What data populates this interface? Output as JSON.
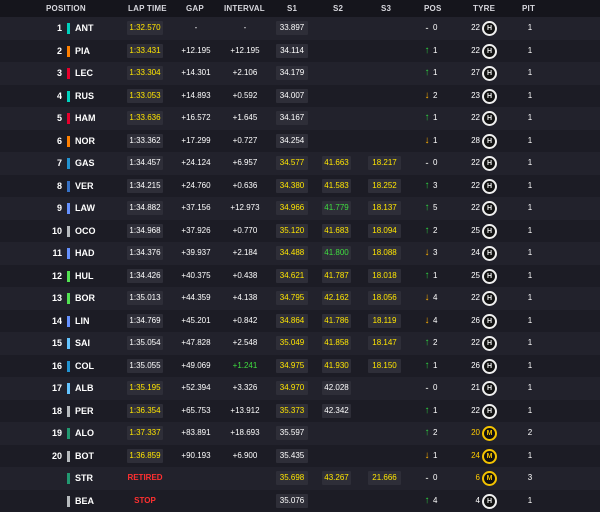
{
  "header": {
    "position": "POSITION",
    "lap_time": "LAP TIME",
    "gap": "GAP",
    "interval": "INTERVAL",
    "s1": "S1",
    "s2": "S2",
    "s3": "S3",
    "pos": "POS",
    "tyre": "TYRE",
    "pit": "PIT"
  },
  "colors": {
    "background": "#1b1b23",
    "sector_purple_or_pb_yellow": "#ffe600",
    "personal_best_green": "#3fdc3f",
    "gain_green": "#2ecc40",
    "loss_amber": "#ffb000",
    "retired_red": "#ff3030",
    "medium_tyre": "#f4c300",
    "hard_tyre": "#f0f0f0"
  },
  "rows": [
    {
      "pos": "1",
      "code": "ANT",
      "team_color": "#00d2be",
      "lap": "1:32.570",
      "lap_style": "yellow box",
      "gap": "-",
      "int": "-",
      "s1": "33.897",
      "s1_style": "white box",
      "s2": "",
      "s2_style": "",
      "s3": "",
      "s3_style": "",
      "dir": "flat",
      "chg": "0",
      "laps": "22",
      "tyre_type": "hard",
      "tyre": "H",
      "pit": "1"
    },
    {
      "pos": "2",
      "code": "PIA",
      "team_color": "#ff8000",
      "lap": "1:33.431",
      "lap_style": "yellow box",
      "gap": "+12.195",
      "int": "+12.195",
      "s1": "34.114",
      "s1_style": "white box",
      "s2": "",
      "s2_style": "",
      "s3": "",
      "s3_style": "",
      "dir": "up",
      "chg": "1",
      "laps": "22",
      "tyre_type": "hard",
      "tyre": "H",
      "pit": "1"
    },
    {
      "pos": "3",
      "code": "LEC",
      "team_color": "#e8002d",
      "lap": "1:33.304",
      "lap_style": "yellow box",
      "gap": "+14.301",
      "int": "+2.106",
      "s1": "34.179",
      "s1_style": "white box",
      "s2": "",
      "s2_style": "",
      "s3": "",
      "s3_style": "",
      "dir": "up",
      "chg": "1",
      "laps": "27",
      "tyre_type": "hard",
      "tyre": "H",
      "pit": "1"
    },
    {
      "pos": "4",
      "code": "RUS",
      "team_color": "#00d2be",
      "lap": "1:33.053",
      "lap_style": "yellow box",
      "gap": "+14.893",
      "int": "+0.592",
      "s1": "34.007",
      "s1_style": "white box",
      "s2": "",
      "s2_style": "",
      "s3": "",
      "s3_style": "",
      "dir": "down",
      "chg": "2",
      "laps": "23",
      "tyre_type": "hard",
      "tyre": "H",
      "pit": "1"
    },
    {
      "pos": "5",
      "code": "HAM",
      "team_color": "#e8002d",
      "lap": "1:33.636",
      "lap_style": "yellow box",
      "gap": "+16.572",
      "int": "+1.645",
      "s1": "34.167",
      "s1_style": "white box",
      "s2": "",
      "s2_style": "",
      "s3": "",
      "s3_style": "",
      "dir": "up",
      "chg": "1",
      "laps": "22",
      "tyre_type": "hard",
      "tyre": "H",
      "pit": "1"
    },
    {
      "pos": "6",
      "code": "NOR",
      "team_color": "#ff8000",
      "lap": "1:33.362",
      "lap_style": "white box",
      "gap": "+17.299",
      "int": "+0.727",
      "s1": "34.254",
      "s1_style": "white box",
      "s2": "",
      "s2_style": "",
      "s3": "",
      "s3_style": "",
      "dir": "down",
      "chg": "1",
      "laps": "28",
      "tyre_type": "hard",
      "tyre": "H",
      "pit": "1"
    },
    {
      "pos": "7",
      "code": "GAS",
      "team_color": "#2293d1",
      "lap": "1:34.457",
      "lap_style": "white box",
      "gap": "+24.124",
      "int": "+6.957",
      "s1": "34.577",
      "s1_style": "yellow box",
      "s2": "41.663",
      "s2_style": "yellow box",
      "s3": "18.217",
      "s3_style": "yellow box",
      "dir": "flat",
      "chg": "0",
      "laps": "22",
      "tyre_type": "hard",
      "tyre": "H",
      "pit": "1"
    },
    {
      "pos": "8",
      "code": "VER",
      "team_color": "#3671c6",
      "lap": "1:34.215",
      "lap_style": "white box",
      "gap": "+24.760",
      "int": "+0.636",
      "s1": "34.380",
      "s1_style": "yellow box",
      "s2": "41.583",
      "s2_style": "yellow box",
      "s3": "18.252",
      "s3_style": "yellow box",
      "dir": "up",
      "chg": "3",
      "laps": "22",
      "tyre_type": "hard",
      "tyre": "H",
      "pit": "1"
    },
    {
      "pos": "9",
      "code": "LAW",
      "team_color": "#6692ff",
      "lap": "1:34.882",
      "lap_style": "white box",
      "gap": "+37.156",
      "int": "+12.973",
      "s1": "34.966",
      "s1_style": "yellow box",
      "s2": "41.779",
      "s2_style": "green box",
      "s3": "18.137",
      "s3_style": "yellow box",
      "dir": "up",
      "chg": "5",
      "laps": "22",
      "tyre_type": "hard",
      "tyre": "H",
      "pit": "1"
    },
    {
      "pos": "10",
      "code": "OCO",
      "team_color": "#b6babd",
      "lap": "1:34.968",
      "lap_style": "white box",
      "gap": "+37.926",
      "int": "+0.770",
      "s1": "35.120",
      "s1_style": "yellow box",
      "s2": "41.683",
      "s2_style": "yellow box",
      "s3": "18.094",
      "s3_style": "yellow box",
      "dir": "up",
      "chg": "2",
      "laps": "25",
      "tyre_type": "hard",
      "tyre": "H",
      "pit": "1"
    },
    {
      "pos": "11",
      "code": "HAD",
      "team_color": "#6692ff",
      "lap": "1:34.376",
      "lap_style": "white box",
      "gap": "+39.937",
      "int": "+2.184",
      "s1": "34.488",
      "s1_style": "yellow box",
      "s2": "41.800",
      "s2_style": "green box",
      "s3": "18.088",
      "s3_style": "yellow box",
      "dir": "down",
      "chg": "3",
      "laps": "24",
      "tyre_type": "hard",
      "tyre": "H",
      "pit": "1"
    },
    {
      "pos": "12",
      "code": "HUL",
      "team_color": "#52e252",
      "lap": "1:34.426",
      "lap_style": "white box",
      "gap": "+40.375",
      "int": "+0.438",
      "s1": "34.621",
      "s1_style": "yellow box",
      "s2": "41.787",
      "s2_style": "yellow box",
      "s3": "18.018",
      "s3_style": "yellow box",
      "dir": "up",
      "chg": "1",
      "laps": "25",
      "tyre_type": "hard",
      "tyre": "H",
      "pit": "1"
    },
    {
      "pos": "13",
      "code": "BOR",
      "team_color": "#52e252",
      "lap": "1:35.013",
      "lap_style": "white box",
      "gap": "+44.359",
      "int": "+4.138",
      "s1": "34.795",
      "s1_style": "yellow box",
      "s2": "42.162",
      "s2_style": "yellow box",
      "s3": "18.056",
      "s3_style": "yellow box",
      "dir": "down",
      "chg": "4",
      "laps": "22",
      "tyre_type": "hard",
      "tyre": "H",
      "pit": "1"
    },
    {
      "pos": "14",
      "code": "LIN",
      "team_color": "#6692ff",
      "lap": "1:34.769",
      "lap_style": "white box",
      "gap": "+45.201",
      "int": "+0.842",
      "s1": "34.864",
      "s1_style": "yellow box",
      "s2": "41.786",
      "s2_style": "yellow box",
      "s3": "18.119",
      "s3_style": "yellow box",
      "dir": "down",
      "chg": "4",
      "laps": "26",
      "tyre_type": "hard",
      "tyre": "H",
      "pit": "1"
    },
    {
      "pos": "15",
      "code": "SAI",
      "team_color": "#64c4ff",
      "lap": "1:35.054",
      "lap_style": "white box",
      "gap": "+47.828",
      "int": "+2.548",
      "s1": "35.049",
      "s1_style": "yellow box",
      "s2": "41.858",
      "s2_style": "yellow box",
      "s3": "18.147",
      "s3_style": "yellow box",
      "dir": "up",
      "chg": "2",
      "laps": "22",
      "tyre_type": "hard",
      "tyre": "H",
      "pit": "1"
    },
    {
      "pos": "16",
      "code": "COL",
      "team_color": "#2293d1",
      "lap": "1:35.055",
      "lap_style": "white box",
      "gap": "+49.069",
      "int": "+1.241",
      "int_style": "green",
      "s1": "34.975",
      "s1_style": "yellow box",
      "s2": "41.930",
      "s2_style": "yellow box",
      "s3": "18.150",
      "s3_style": "yellow box",
      "dir": "up",
      "chg": "1",
      "laps": "26",
      "tyre_type": "hard",
      "tyre": "H",
      "pit": "1"
    },
    {
      "pos": "17",
      "code": "ALB",
      "team_color": "#64c4ff",
      "lap": "1:35.195",
      "lap_style": "yellow box",
      "gap": "+52.394",
      "int": "+3.326",
      "s1": "34.970",
      "s1_style": "yellow box",
      "s2": "42.028",
      "s2_style": "white box",
      "s3": "",
      "s3_style": "",
      "dir": "flat",
      "chg": "0",
      "laps": "21",
      "tyre_type": "hard",
      "tyre": "H",
      "pit": "1"
    },
    {
      "pos": "18",
      "code": "PER",
      "team_color": "#b6babd",
      "lap": "1:36.354",
      "lap_style": "yellow box",
      "gap": "+65.753",
      "int": "+13.912",
      "s1": "35.373",
      "s1_style": "yellow box",
      "s2": "42.342",
      "s2_style": "white box",
      "s3": "",
      "s3_style": "",
      "dir": "up",
      "chg": "1",
      "laps": "22",
      "tyre_type": "hard",
      "tyre": "H",
      "pit": "1"
    },
    {
      "pos": "19",
      "code": "ALO",
      "team_color": "#229971",
      "lap": "1:37.337",
      "lap_style": "yellow box",
      "gap": "+83.891",
      "int": "+18.693",
      "s1": "35.597",
      "s1_style": "white box",
      "s2": "",
      "s2_style": "",
      "s3": "",
      "s3_style": "",
      "dir": "up",
      "chg": "2",
      "laps": "20",
      "laps_hl": true,
      "tyre_type": "medium",
      "tyre": "M",
      "pit": "2"
    },
    {
      "pos": "20",
      "code": "BOT",
      "team_color": "#b6babd",
      "lap": "1:36.859",
      "lap_style": "yellow box",
      "gap": "+90.193",
      "int": "+6.900",
      "s1": "35.435",
      "s1_style": "white box",
      "s2": "",
      "s2_style": "",
      "s3": "",
      "s3_style": "",
      "dir": "down",
      "chg": "1",
      "laps": "24",
      "laps_hl": true,
      "tyre_type": "medium",
      "tyre": "M",
      "pit": "1"
    },
    {
      "pos": "",
      "code": "STR",
      "team_color": "#229971",
      "lap": "RETIRED",
      "lap_style": "red",
      "gap": "",
      "int": "",
      "s1": "35.698",
      "s1_style": "yellow box",
      "s2": "43.267",
      "s2_style": "yellow box",
      "s3": "21.666",
      "s3_style": "yellow box",
      "dir": "flat",
      "chg": "0",
      "laps": "6",
      "laps_hl": true,
      "tyre_type": "medium",
      "tyre": "M",
      "pit": "3"
    },
    {
      "pos": "",
      "code": "BEA",
      "team_color": "#b6babd",
      "lap": "STOP",
      "lap_style": "red",
      "gap": "",
      "int": "",
      "s1": "35.076",
      "s1_style": "white box",
      "s2": "",
      "s2_style": "",
      "s3": "",
      "s3_style": "",
      "dir": "up",
      "chg": "4",
      "laps": "4",
      "laps_hl": false,
      "tyre_type": "hard",
      "tyre": "H",
      "pit": "1"
    }
  ]
}
